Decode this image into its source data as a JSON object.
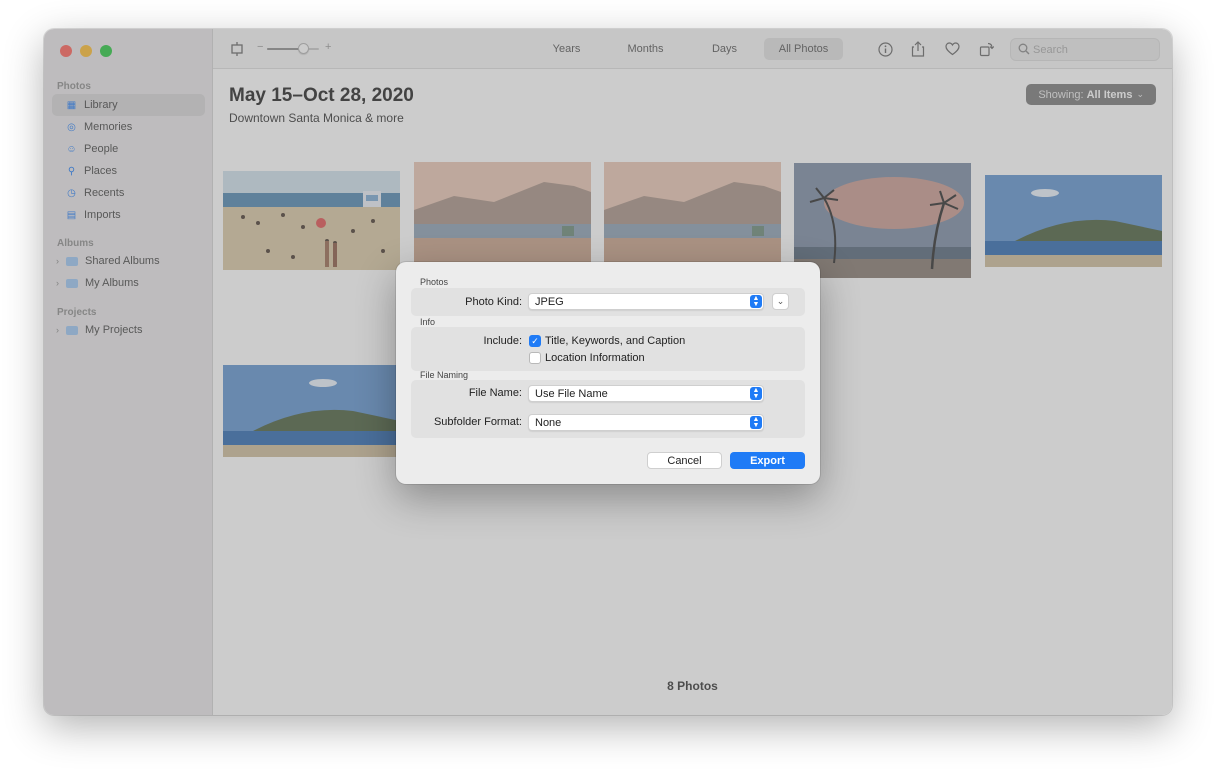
{
  "sidebar": {
    "sections": {
      "photos": "Photos",
      "albums": "Albums",
      "projects": "Projects"
    },
    "photos_items": [
      {
        "label": "Library",
        "icon": "library-icon"
      },
      {
        "label": "Memories",
        "icon": "memories-icon"
      },
      {
        "label": "People",
        "icon": "people-icon"
      },
      {
        "label": "Places",
        "icon": "places-icon"
      },
      {
        "label": "Recents",
        "icon": "recents-icon"
      },
      {
        "label": "Imports",
        "icon": "imports-icon"
      }
    ],
    "albums_items": [
      {
        "label": "Shared Albums",
        "icon": "folder-icon"
      },
      {
        "label": "My Albums",
        "icon": "folder-icon"
      }
    ],
    "projects_items": [
      {
        "label": "My Projects",
        "icon": "folder-icon"
      }
    ],
    "selected": "Library"
  },
  "toolbar": {
    "view_tabs": [
      "Years",
      "Months",
      "Days",
      "All Photos"
    ],
    "active_tab": "All Photos",
    "zoom_level": 0.7,
    "search_placeholder": "Search",
    "icons": [
      "slideshow-icon",
      "zoom-slider",
      "info-icon",
      "share-icon",
      "favorite-icon",
      "rotate-icon",
      "search-icon"
    ]
  },
  "content": {
    "title": "May 15–Oct 28, 2020",
    "subtitle": "Downtown Santa Monica & more",
    "showing_prefix": "Showing:",
    "showing_value": "All Items",
    "photo_count": "8 Photos"
  },
  "dialog": {
    "photos_header": "Photos",
    "photo_kind_label": "Photo Kind:",
    "photo_kind_value": "JPEG",
    "info_header": "Info",
    "include_label": "Include:",
    "include_title_keywords": "Title, Keywords, and Caption",
    "include_title_keywords_checked": true,
    "include_location": "Location Information",
    "include_location_checked": false,
    "file_naming_header": "File Naming",
    "file_name_label": "File Name:",
    "file_name_value": "Use File Name",
    "subfolder_label": "Subfolder Format:",
    "subfolder_value": "None",
    "cancel": "Cancel",
    "export": "Export"
  },
  "colors": {
    "accent": "#1f7bf6",
    "window_bg": "#f2f2f2",
    "overlay": "rgba(120,120,120,0.38)"
  }
}
